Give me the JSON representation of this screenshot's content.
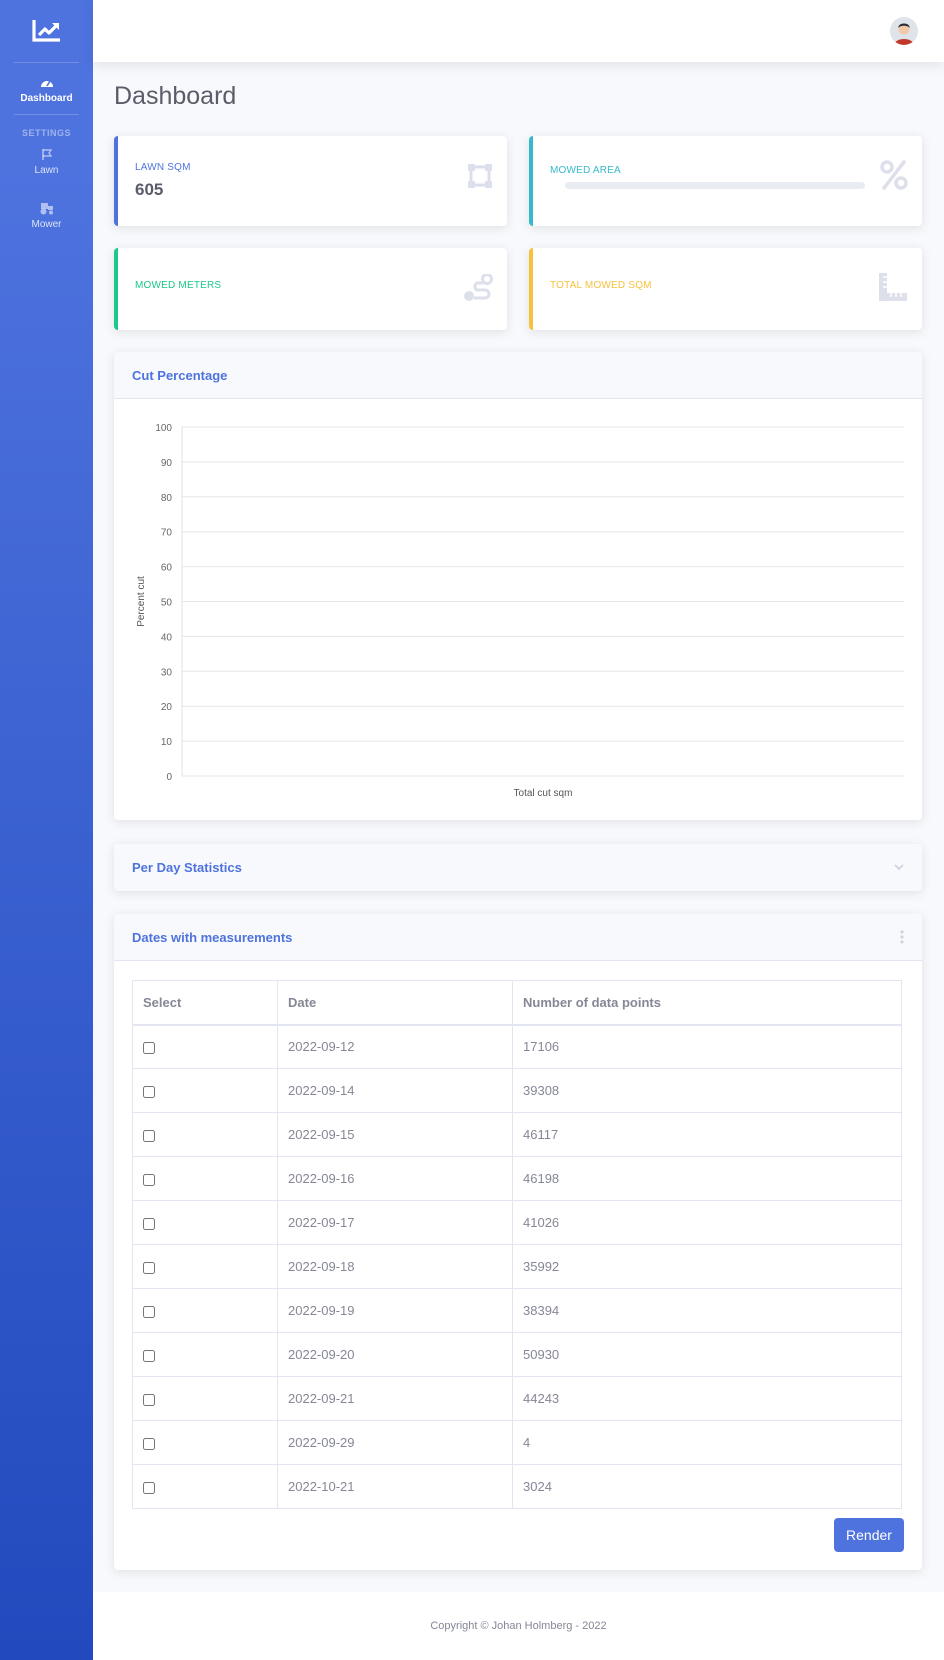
{
  "sidebar": {
    "brand_icon": "chart-line-icon",
    "items": [
      {
        "label": "Dashboard",
        "icon": "tachometer-icon",
        "active": true
      }
    ],
    "heading": "SETTINGS",
    "settings_items": [
      {
        "label": "Lawn",
        "icon": "flag-icon"
      },
      {
        "label": "Mower",
        "icon": "tractor-icon"
      }
    ]
  },
  "page": {
    "title": "Dashboard"
  },
  "stats": {
    "lawn_sqm": {
      "label": "LAWN SQM",
      "value": "605",
      "color": "#4e73df",
      "icon": "vector-square-icon"
    },
    "mowed_area": {
      "label": "MOWED AREA",
      "progress": 0,
      "color": "#36b9cc",
      "icon": "percent-icon"
    },
    "mowed_meters": {
      "label": "MOWED METERS",
      "color": "#1cc88a",
      "icon": "route-icon"
    },
    "total_mowed_sqm": {
      "label": "TOTAL MOWED SQM",
      "color": "#f6c23e",
      "icon": "ruler-combined-icon"
    }
  },
  "cut_percentage": {
    "title": "Cut Percentage"
  },
  "chart_data": {
    "type": "line",
    "title": "",
    "xlabel": "Total cut sqm",
    "ylabel": "Percent cut",
    "ylim": [
      0,
      100
    ],
    "yticks": [
      0,
      10,
      20,
      30,
      40,
      50,
      60,
      70,
      80,
      90,
      100
    ],
    "series": [],
    "grid": true
  },
  "per_day": {
    "title": "Per Day Statistics",
    "icon": "chevron-down-icon"
  },
  "dates": {
    "title": "Dates with measurements",
    "menu_icon": "ellipsis-vertical-icon",
    "columns": [
      "Select",
      "Date",
      "Number of data points"
    ],
    "rows": [
      {
        "date": "2022-09-12",
        "points": "17106"
      },
      {
        "date": "2022-09-14",
        "points": "39308"
      },
      {
        "date": "2022-09-15",
        "points": "46117"
      },
      {
        "date": "2022-09-16",
        "points": "46198"
      },
      {
        "date": "2022-09-17",
        "points": "41026"
      },
      {
        "date": "2022-09-18",
        "points": "35992"
      },
      {
        "date": "2022-09-19",
        "points": "38394"
      },
      {
        "date": "2022-09-20",
        "points": "50930"
      },
      {
        "date": "2022-09-21",
        "points": "44243"
      },
      {
        "date": "2022-09-29",
        "points": "4"
      },
      {
        "date": "2022-10-21",
        "points": "3024"
      }
    ],
    "render_label": "Render"
  },
  "footer": {
    "text": "Copyright © Johan Holmberg - 2022"
  }
}
